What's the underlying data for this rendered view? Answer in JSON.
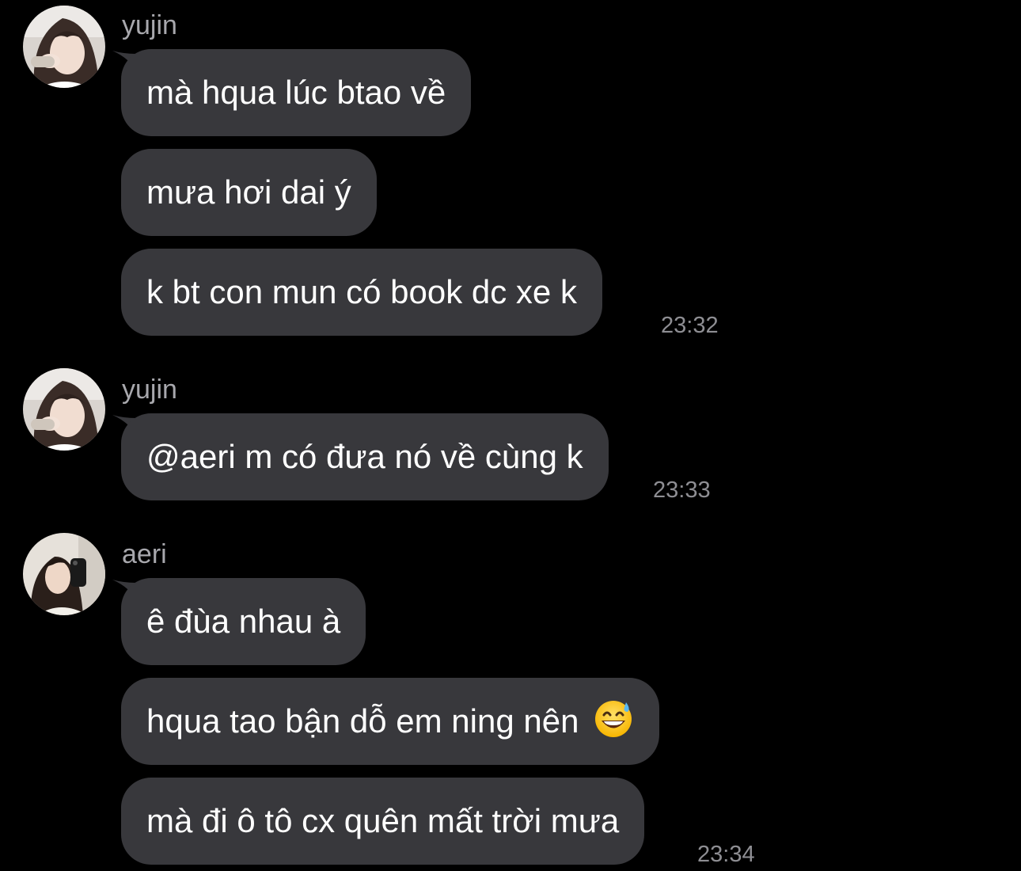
{
  "groups": [
    {
      "sender": "yujin",
      "avatar_icon": "profile-photo-girl-hand-on-face",
      "messages": [
        "mà hqua lúc btao về",
        "mưa hơi dai ý",
        "k bt con mun có book dc xe k"
      ],
      "time": "23:32"
    },
    {
      "sender": "yujin",
      "avatar_icon": "profile-photo-girl-hand-on-face",
      "messages": [
        "@aeri m có đưa nó về cùng k"
      ],
      "time": "23:33"
    },
    {
      "sender": "aeri",
      "avatar_icon": "profile-photo-mirror-selfie",
      "messages": [
        "ê đùa nhau à",
        "hqua tao bận dỗ em ning nên",
        "mà đi ô tô cx quên mất trời mưa"
      ],
      "emoji_icon": "grinning-face-with-sweat-emoji",
      "time": "23:34"
    }
  ],
  "colors": {
    "background": "#000000",
    "bubble": "#38383c",
    "text": "#ffffff",
    "sender": "#a8a8ad",
    "time": "#8e8e93"
  }
}
